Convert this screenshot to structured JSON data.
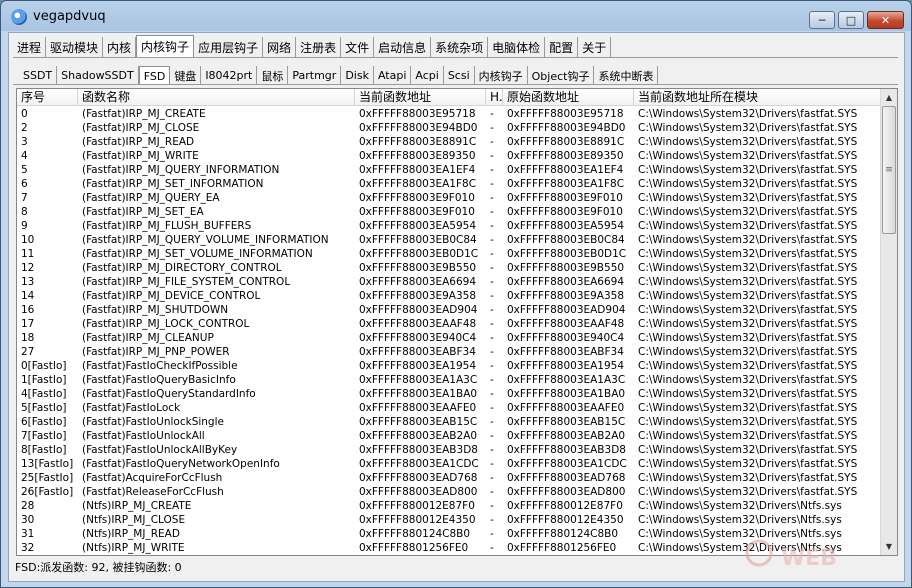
{
  "window": {
    "title": "vegapdvuq"
  },
  "main_tabs": [
    "进程",
    "驱动模块",
    "内核",
    "内核钩子",
    "应用层钩子",
    "网络",
    "注册表",
    "文件",
    "启动信息",
    "系统杂项",
    "电脑体检",
    "配置",
    "关于"
  ],
  "main_active": 3,
  "sub_tabs": [
    "SSDT",
    "ShadowSSDT",
    "FSD",
    "键盘",
    "I8042prt",
    "鼠标",
    "Partmgr",
    "Disk",
    "Atapi",
    "Acpi",
    "Scsi",
    "内核钩子",
    "Object钩子",
    "系统中断表"
  ],
  "sub_active": 2,
  "table": {
    "headers": [
      "序号",
      "函数名称",
      "当前函数地址",
      "H...",
      "原始函数地址",
      "当前函数地址所在模块"
    ],
    "rows": [
      [
        "0",
        "(Fastfat)IRP_MJ_CREATE",
        "0xFFFFF88003E95718",
        "-",
        "0xFFFFF88003E95718",
        "C:\\Windows\\System32\\Drivers\\fastfat.SYS"
      ],
      [
        "2",
        "(Fastfat)IRP_MJ_CLOSE",
        "0xFFFFF88003E94BD0",
        "-",
        "0xFFFFF88003E94BD0",
        "C:\\Windows\\System32\\Drivers\\fastfat.SYS"
      ],
      [
        "3",
        "(Fastfat)IRP_MJ_READ",
        "0xFFFFF88003E8891C",
        "-",
        "0xFFFFF88003E8891C",
        "C:\\Windows\\System32\\Drivers\\fastfat.SYS"
      ],
      [
        "4",
        "(Fastfat)IRP_MJ_WRITE",
        "0xFFFFF88003E89350",
        "-",
        "0xFFFFF88003E89350",
        "C:\\Windows\\System32\\Drivers\\fastfat.SYS"
      ],
      [
        "5",
        "(Fastfat)IRP_MJ_QUERY_INFORMATION",
        "0xFFFFF88003EA1EF4",
        "-",
        "0xFFFFF88003EA1EF4",
        "C:\\Windows\\System32\\Drivers\\fastfat.SYS"
      ],
      [
        "6",
        "(Fastfat)IRP_MJ_SET_INFORMATION",
        "0xFFFFF88003EA1F8C",
        "-",
        "0xFFFFF88003EA1F8C",
        "C:\\Windows\\System32\\Drivers\\fastfat.SYS"
      ],
      [
        "7",
        "(Fastfat)IRP_MJ_QUERY_EA",
        "0xFFFFF88003E9F010",
        "-",
        "0xFFFFF88003E9F010",
        "C:\\Windows\\System32\\Drivers\\fastfat.SYS"
      ],
      [
        "8",
        "(Fastfat)IRP_MJ_SET_EA",
        "0xFFFFF88003E9F010",
        "-",
        "0xFFFFF88003E9F010",
        "C:\\Windows\\System32\\Drivers\\fastfat.SYS"
      ],
      [
        "9",
        "(Fastfat)IRP_MJ_FLUSH_BUFFERS",
        "0xFFFFF88003EA5954",
        "-",
        "0xFFFFF88003EA5954",
        "C:\\Windows\\System32\\Drivers\\fastfat.SYS"
      ],
      [
        "10",
        "(Fastfat)IRP_MJ_QUERY_VOLUME_INFORMATION",
        "0xFFFFF88003EB0C84",
        "-",
        "0xFFFFF88003EB0C84",
        "C:\\Windows\\System32\\Drivers\\fastfat.SYS"
      ],
      [
        "11",
        "(Fastfat)IRP_MJ_SET_VOLUME_INFORMATION",
        "0xFFFFF88003EB0D1C",
        "-",
        "0xFFFFF88003EB0D1C",
        "C:\\Windows\\System32\\Drivers\\fastfat.SYS"
      ],
      [
        "12",
        "(Fastfat)IRP_MJ_DIRECTORY_CONTROL",
        "0xFFFFF88003E9B550",
        "-",
        "0xFFFFF88003E9B550",
        "C:\\Windows\\System32\\Drivers\\fastfat.SYS"
      ],
      [
        "13",
        "(Fastfat)IRP_MJ_FILE_SYSTEM_CONTROL",
        "0xFFFFF88003EA6694",
        "-",
        "0xFFFFF88003EA6694",
        "C:\\Windows\\System32\\Drivers\\fastfat.SYS"
      ],
      [
        "14",
        "(Fastfat)IRP_MJ_DEVICE_CONTROL",
        "0xFFFFF88003E9A358",
        "-",
        "0xFFFFF88003E9A358",
        "C:\\Windows\\System32\\Drivers\\fastfat.SYS"
      ],
      [
        "16",
        "(Fastfat)IRP_MJ_SHUTDOWN",
        "0xFFFFF88003EAD904",
        "-",
        "0xFFFFF88003EAD904",
        "C:\\Windows\\System32\\Drivers\\fastfat.SYS"
      ],
      [
        "17",
        "(Fastfat)IRP_MJ_LOCK_CONTROL",
        "0xFFFFF88003EAAF48",
        "-",
        "0xFFFFF88003EAAF48",
        "C:\\Windows\\System32\\Drivers\\fastfat.SYS"
      ],
      [
        "18",
        "(Fastfat)IRP_MJ_CLEANUP",
        "0xFFFFF88003E940C4",
        "-",
        "0xFFFFF88003E940C4",
        "C:\\Windows\\System32\\Drivers\\fastfat.SYS"
      ],
      [
        "27",
        "(Fastfat)IRP_MJ_PNP_POWER",
        "0xFFFFF88003EABF34",
        "-",
        "0xFFFFF88003EABF34",
        "C:\\Windows\\System32\\Drivers\\fastfat.SYS"
      ],
      [
        "0[FastIo]",
        "(Fastfat)FastIoCheckIfPossible",
        "0xFFFFF88003EA1954",
        "-",
        "0xFFFFF88003EA1954",
        "C:\\Windows\\System32\\Drivers\\fastfat.SYS"
      ],
      [
        "1[FastIo]",
        "(Fastfat)FastIoQueryBasicInfo",
        "0xFFFFF88003EA1A3C",
        "-",
        "0xFFFFF88003EA1A3C",
        "C:\\Windows\\System32\\Drivers\\fastfat.SYS"
      ],
      [
        "4[FastIo]",
        "(Fastfat)FastIoQueryStandardInfo",
        "0xFFFFF88003EA1BA0",
        "-",
        "0xFFFFF88003EA1BA0",
        "C:\\Windows\\System32\\Drivers\\fastfat.SYS"
      ],
      [
        "5[FastIo]",
        "(Fastfat)FastIoLock",
        "0xFFFFF88003EAAFE0",
        "-",
        "0xFFFFF88003EAAFE0",
        "C:\\Windows\\System32\\Drivers\\fastfat.SYS"
      ],
      [
        "6[FastIo]",
        "(Fastfat)FastIoUnlockSingle",
        "0xFFFFF88003EAB15C",
        "-",
        "0xFFFFF88003EAB15C",
        "C:\\Windows\\System32\\Drivers\\fastfat.SYS"
      ],
      [
        "7[FastIo]",
        "(Fastfat)FastIoUnlockAll",
        "0xFFFFF88003EAB2A0",
        "-",
        "0xFFFFF88003EAB2A0",
        "C:\\Windows\\System32\\Drivers\\fastfat.SYS"
      ],
      [
        "8[FastIo]",
        "(Fastfat)FastIoUnlockAllByKey",
        "0xFFFFF88003EAB3D8",
        "-",
        "0xFFFFF88003EAB3D8",
        "C:\\Windows\\System32\\Drivers\\fastfat.SYS"
      ],
      [
        "13[FastIo]",
        "(Fastfat)FastIoQueryNetworkOpenInfo",
        "0xFFFFF88003EA1CDC",
        "-",
        "0xFFFFF88003EA1CDC",
        "C:\\Windows\\System32\\Drivers\\fastfat.SYS"
      ],
      [
        "25[FastIo]",
        "(Fastfat)AcquireForCcFlush",
        "0xFFFFF88003EAD768",
        "-",
        "0xFFFFF88003EAD768",
        "C:\\Windows\\System32\\Drivers\\fastfat.SYS"
      ],
      [
        "26[FastIo]",
        "(Fastfat)ReleaseForCcFlush",
        "0xFFFFF88003EAD800",
        "-",
        "0xFFFFF88003EAD800",
        "C:\\Windows\\System32\\Drivers\\fastfat.SYS"
      ],
      [
        "28",
        "(Ntfs)IRP_MJ_CREATE",
        "0xFFFFF880012E87F0",
        "-",
        "0xFFFFF880012E87F0",
        "C:\\Windows\\System32\\Drivers\\Ntfs.sys"
      ],
      [
        "30",
        "(Ntfs)IRP_MJ_CLOSE",
        "0xFFFFF880012E4350",
        "-",
        "0xFFFFF880012E4350",
        "C:\\Windows\\System32\\Drivers\\Ntfs.sys"
      ],
      [
        "31",
        "(Ntfs)IRP_MJ_READ",
        "0xFFFFF880124C8B0",
        "-",
        "0xFFFFF880124C8B0",
        "C:\\Windows\\System32\\Drivers\\Ntfs.sys"
      ],
      [
        "32",
        "(Ntfs)IRP_MJ_WRITE",
        "0xFFFFF8801256FE0",
        "-",
        "0xFFFFF8801256FE0",
        "C:\\Windows\\System32\\Drivers\\Ntfs.sys"
      ]
    ]
  },
  "status": {
    "text": "FSD:派发函数: 92, 被挂钩函数: 0"
  },
  "icons": {
    "app": "app-globe-icon",
    "min": "minimize-icon",
    "max": "maximize-icon",
    "close": "close-icon"
  },
  "watermark": {
    "text": "WEB"
  },
  "colors": {
    "title_bar": "#b9d1ea",
    "close_button": "#c44a2e"
  }
}
